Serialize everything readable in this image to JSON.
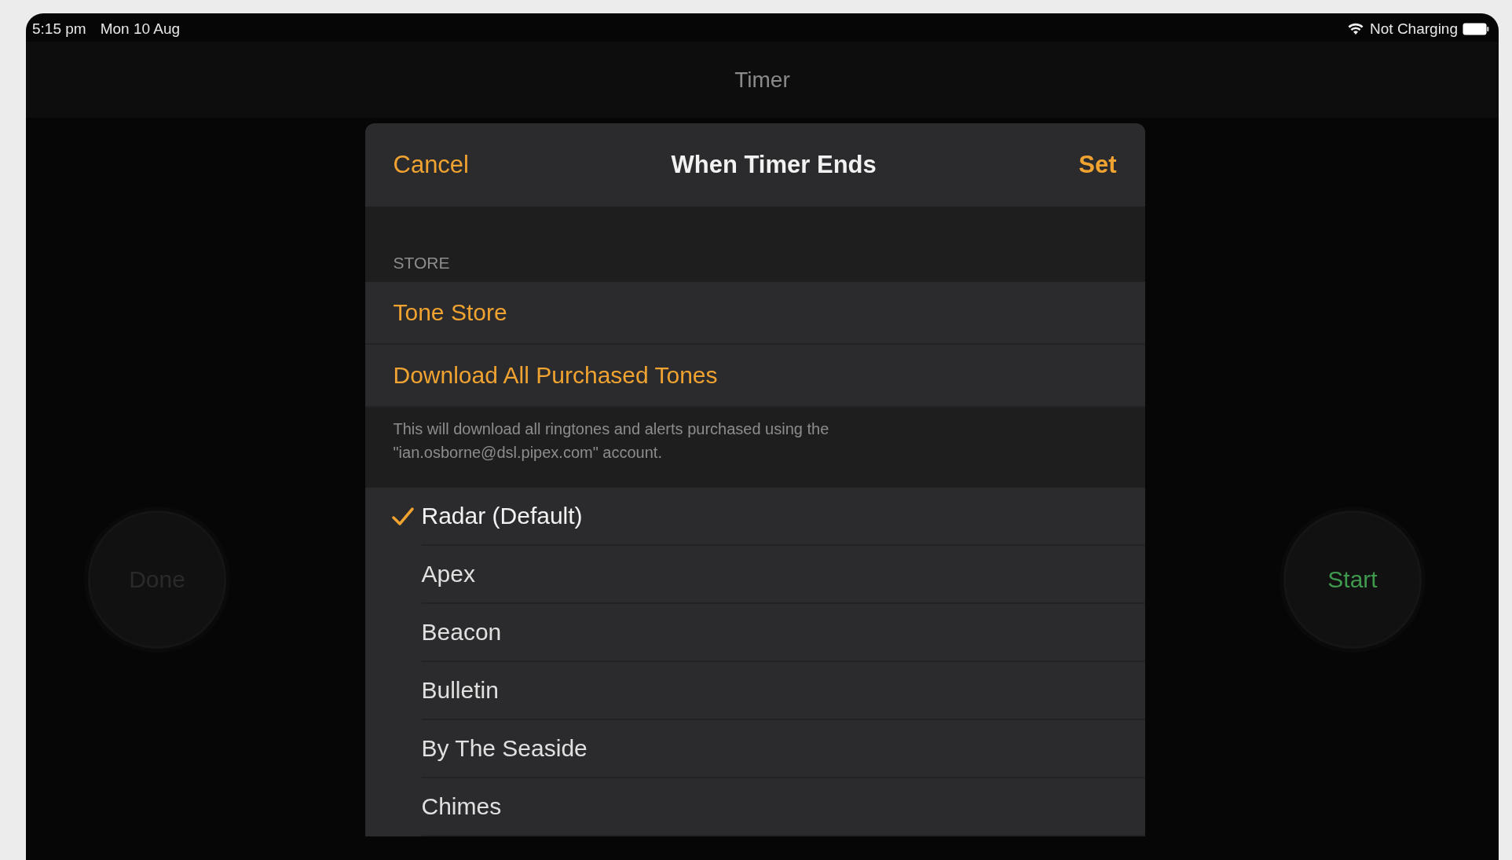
{
  "status_bar": {
    "time": "5:15 pm",
    "date": "Mon 10 Aug",
    "battery_label": "Not Charging"
  },
  "nav": {
    "title": "Timer"
  },
  "timer_buttons": [
    {
      "label": "Done",
      "kind": "done"
    },
    {
      "label": "Start",
      "kind": "start"
    }
  ],
  "sheet": {
    "cancel": "Cancel",
    "title": "When Timer Ends",
    "set": "Set",
    "store_header": "STORE",
    "store_items": [
      "Tone Store",
      "Download All Purchased Tones"
    ],
    "store_footer": "This will download all ringtones and alerts purchased using the \"ian.osborne@dsl.pipex.com\" account.",
    "tones": [
      {
        "name": "Radar (Default)",
        "selected": true
      },
      {
        "name": "Apex",
        "selected": false
      },
      {
        "name": "Beacon",
        "selected": false
      },
      {
        "name": "Bulletin",
        "selected": false
      },
      {
        "name": "By The Seaside",
        "selected": false
      },
      {
        "name": "Chimes",
        "selected": false
      }
    ]
  }
}
